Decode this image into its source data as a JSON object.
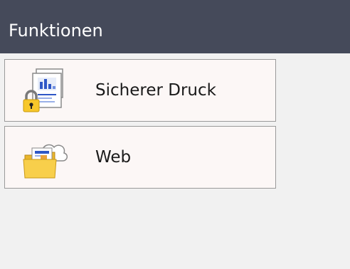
{
  "header": {
    "title": "Funktionen"
  },
  "menu": {
    "items": [
      {
        "label": "Sicherer Druck",
        "icon": "secure-print-icon"
      },
      {
        "label": "Web",
        "icon": "web-folder-icon"
      }
    ]
  },
  "colors": {
    "header_bg": "#454a5a",
    "header_text": "#ffffff",
    "item_bg": "#fcf7f6",
    "page_bg": "#f1f1f1",
    "lock_yellow": "#f7c72a",
    "folder_yellow": "#f8cf4b",
    "chart_blue": "#2f57c6"
  }
}
